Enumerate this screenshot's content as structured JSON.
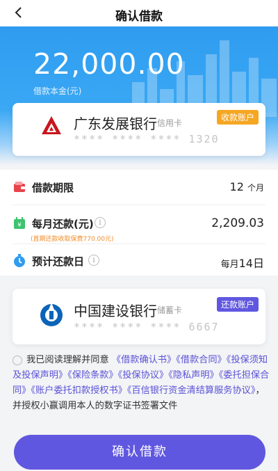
{
  "nav": {
    "title": "确认借款"
  },
  "loan": {
    "amount": "22,000.00",
    "amount_label": "借款本金(元)"
  },
  "receive_card": {
    "bank": "广东发展银行",
    "type": "信用卡",
    "masked": "****  ****  ****  1320",
    "badge": "收款账户",
    "badge_color": "#f5a623"
  },
  "details": {
    "term_label": "借款期限",
    "term_value": "12",
    "term_unit": "个月",
    "monthly_label": "每月还款(元)",
    "monthly_value": "2,209.03",
    "monthly_note": "(首期还款收取保费770.00元)",
    "date_label": "预计还款日",
    "date_prefix": "每月",
    "date_value": "14日"
  },
  "repay_card": {
    "bank": "中国建设银行",
    "type": "储蓄卡",
    "masked": "****  ****  ****  6667",
    "badge": "还款账户",
    "badge_color": "#6057e0"
  },
  "agreement": {
    "prefix": "我已阅读理解并同意",
    "links": [
      "《借款确认书》",
      "《借款合同》",
      "《投保须知及投保声明》",
      "《保险条款》",
      "《投保协议》",
      "《隐私声明》",
      "《委托担保合同》",
      "《账户委托扣款授权书》",
      "《百信银行资金清结算服务协议》"
    ],
    "suffix": "，并授权小赢调用本人的数字证书签署文件"
  },
  "submit_label": "确认借款",
  "colors": {
    "primary": "#6057e0",
    "hero": "#2f9cf0",
    "warning": "#f28c28"
  }
}
